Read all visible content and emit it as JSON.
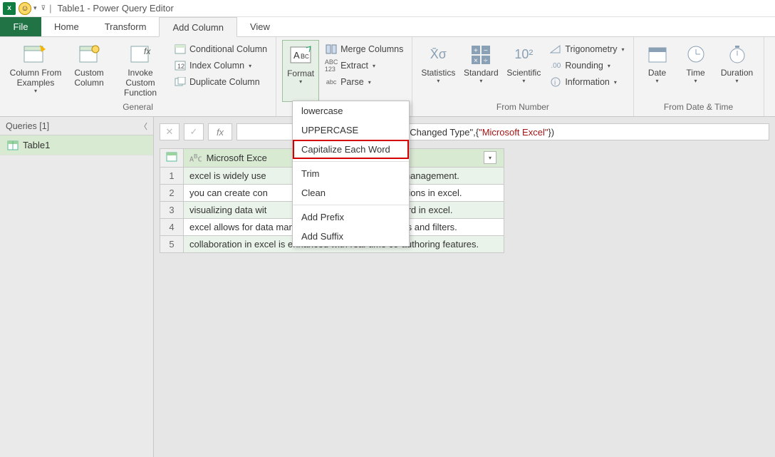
{
  "title": "Table1 - Power Query Editor",
  "tabs": {
    "file": "File",
    "home": "Home",
    "transform": "Transform",
    "addcol": "Add Column",
    "view": "View"
  },
  "groups": {
    "general": {
      "label": "General",
      "col_from_examples": "Column From Examples",
      "custom_col": "Custom Column",
      "invoke_custom": "Invoke Custom Function",
      "conditional": "Conditional Column",
      "index": "Index Column",
      "duplicate": "Duplicate Column"
    },
    "text": {
      "format": "Format",
      "merge": "Merge Columns",
      "extract": "Extract",
      "parse": "Parse"
    },
    "number": {
      "label": "From Number",
      "statistics": "Statistics",
      "standard": "Standard",
      "scientific": "Scientific",
      "trig": "Trigonometry",
      "rounding": "Rounding",
      "info": "Information"
    },
    "datetime": {
      "label": "From Date & Time",
      "date": "Date",
      "time": "Time",
      "duration": "Duration"
    }
  },
  "format_menu": {
    "lower": "lowercase",
    "upper": "UPPERCASE",
    "cap": "Capitalize Each Word",
    "trim": "Trim",
    "clean": "Clean",
    "prefix": "Add Prefix",
    "suffix": "Add Suffix"
  },
  "queries": {
    "header": "Queries [1]",
    "item1": "Table1"
  },
  "formula": {
    "prefix_visible": "\"Changed Type\",{",
    "string": "\"Microsoft Excel\"",
    "suffix": "})"
  },
  "grid": {
    "col_header_visible": "Microsoft Exce",
    "rows": [
      "excel is widely use",
      "you can create con",
      "visualizing data wit",
      "excel allows for data manipulation through pivot tables and filters.",
      "collaboration in excel is enhanced with real-time co-authoring features."
    ],
    "row_suffix": {
      "0": "eet management.",
      "1": "culations in excel.",
      "2": "orward in excel."
    }
  }
}
